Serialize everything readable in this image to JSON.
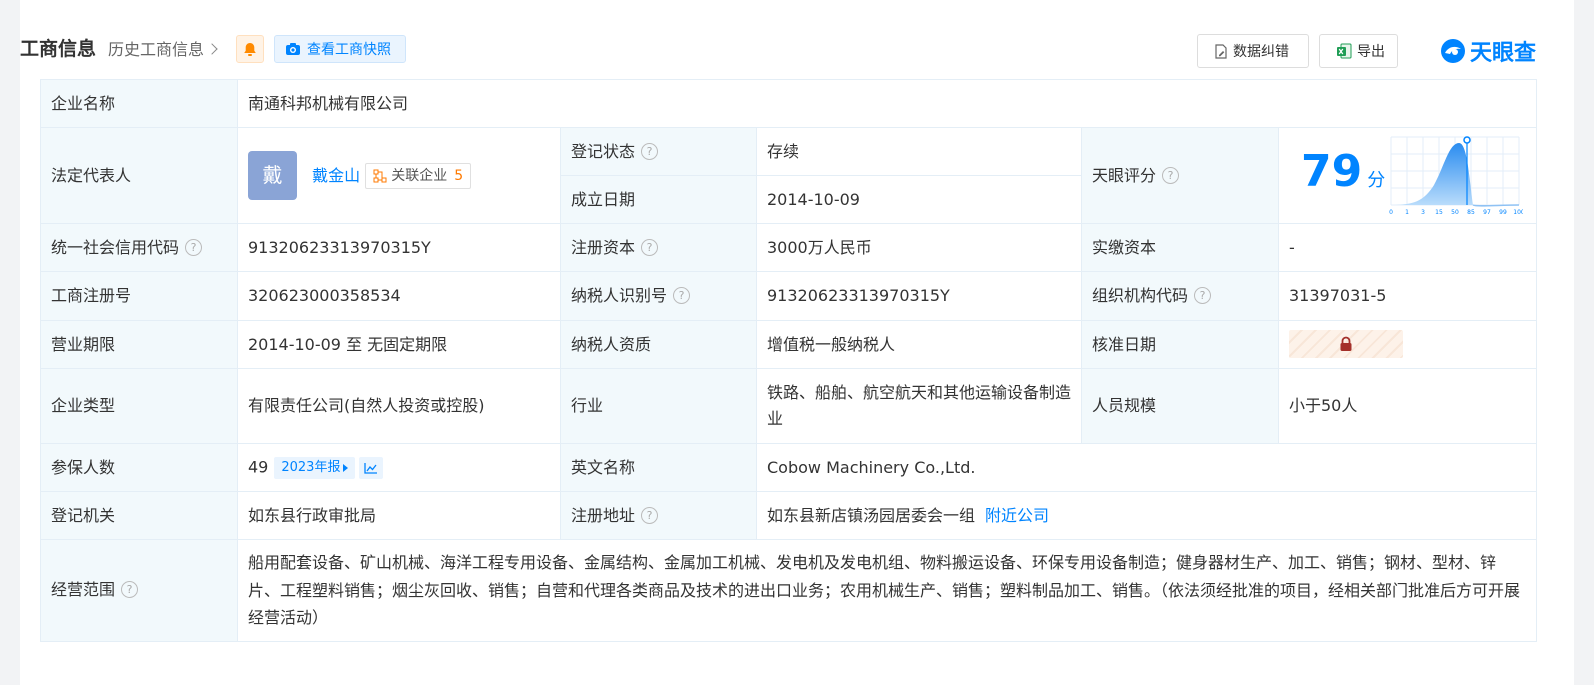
{
  "header": {
    "title": "工商信息",
    "history_label": "历史工商信息",
    "snapshot_label": "查看工商快照",
    "correct_label": "数据纠错",
    "export_label": "导出",
    "logo_text": "天眼查"
  },
  "rows": {
    "company_name_label": "企业名称",
    "company_name": "南通科邦机械有限公司",
    "legal_rep_label": "法定代表人",
    "legal_rep_avatar": "戴",
    "legal_rep_name": "戴金山",
    "related_label": "关联企业",
    "related_count": "5",
    "reg_status_label": "登记状态",
    "reg_status": "存续",
    "founded_label": "成立日期",
    "founded": "2014-10-09",
    "score_label": "天眼评分",
    "score_value": "79",
    "score_unit": "分",
    "credit_code_label": "统一社会信用代码",
    "credit_code": "91320623313970315Y",
    "reg_capital_label": "注册资本",
    "reg_capital": "3000万人民币",
    "paid_capital_label": "实缴资本",
    "paid_capital": "-",
    "biz_reg_no_label": "工商注册号",
    "biz_reg_no": "320623000358534",
    "taxpayer_id_label": "纳税人识别号",
    "taxpayer_id": "91320623313970315Y",
    "org_code_label": "组织机构代码",
    "org_code": "31397031-5",
    "term_label": "营业期限",
    "term": "2014-10-09 至 无固定期限",
    "tax_qual_label": "纳税人资质",
    "tax_qual": "增值税一般纳税人",
    "approve_date_label": "核准日期",
    "type_label": "企业类型",
    "type": "有限责任公司(自然人投资或控股)",
    "industry_label": "行业",
    "industry": "铁路、船舶、航空航天和其他运输设备制造业",
    "staff_size_label": "人员规模",
    "staff_size": "小于50人",
    "insured_label": "参保人数",
    "insured": "49",
    "insured_report": "2023年报",
    "english_name_label": "英文名称",
    "english_name": "Cobow Machinery Co.,Ltd.",
    "authority_label": "登记机关",
    "authority": "如东县行政审批局",
    "address_label": "注册地址",
    "address": "如东县新店镇汤园居委会一组",
    "nearby_label": "附近公司",
    "scope_label": "经营范围",
    "scope": "船用配套设备、矿山机械、海洋工程专用设备、金属结构、金属加工机械、发电机及发电机组、物料搬运设备、环保专用设备制造；健身器材生产、加工、销售；钢材、型材、锌片、工程塑料销售；烟尘灰回收、销售；自营和代理各类商品及技术的进出口业务；农用机械生产、销售；塑料制品加工、销售。（依法须经批准的项目，经相关部门批准后方可开展经营活动）"
  },
  "score_chart_ticks": [
    "0",
    "1",
    "3",
    "15",
    "50",
    "85",
    "97",
    "99",
    "100"
  ],
  "colors": {
    "accent": "#0084ff",
    "status_green": "#00a35a",
    "label_bg": "#f2f9fc",
    "border": "#e4eef6"
  }
}
